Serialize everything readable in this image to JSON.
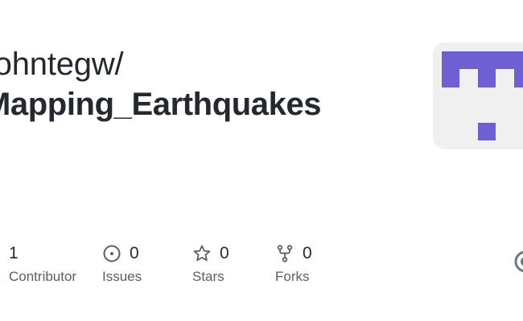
{
  "repository": {
    "owner": "johntegw/",
    "name": "Mapping_Earthquakes"
  },
  "stats": [
    {
      "key": "contributors",
      "value": "1",
      "label": "Contributor",
      "icon": "none"
    },
    {
      "key": "issues",
      "value": "0",
      "label": "Issues",
      "icon": "issue-opened-icon"
    },
    {
      "key": "stars",
      "value": "0",
      "label": "Stars",
      "icon": "star-icon"
    },
    {
      "key": "forks",
      "value": "0",
      "label": "Forks",
      "icon": "repo-forked-icon"
    }
  ],
  "colors": {
    "text_primary": "#24292f",
    "text_muted": "#57606a",
    "avatar_background": "#f0f0f0",
    "avatar_pattern": "#6e5fd3"
  }
}
